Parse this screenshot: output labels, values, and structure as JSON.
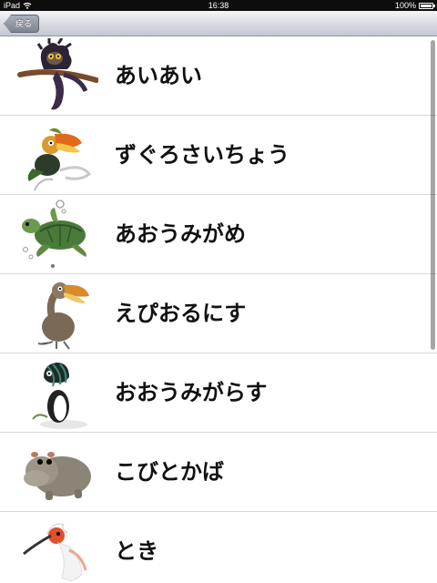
{
  "status": {
    "device": "iPad",
    "time": "16:38",
    "battery": "100%",
    "battery_level": 1.0
  },
  "nav": {
    "back_label": "戻る"
  },
  "items": [
    {
      "label": "あいあい",
      "icon": "aye-aye-icon"
    },
    {
      "label": "ずぐろさいちょう",
      "icon": "hornbill-icon"
    },
    {
      "label": "あおうみがめ",
      "icon": "sea-turtle-icon"
    },
    {
      "label": "えぴおるにす",
      "icon": "aepyornis-icon"
    },
    {
      "label": "おおうみがらす",
      "icon": "great-auk-icon"
    },
    {
      "label": "こびとかば",
      "icon": "pygmy-hippo-icon"
    },
    {
      "label": "とき",
      "icon": "crested-ibis-icon"
    }
  ]
}
